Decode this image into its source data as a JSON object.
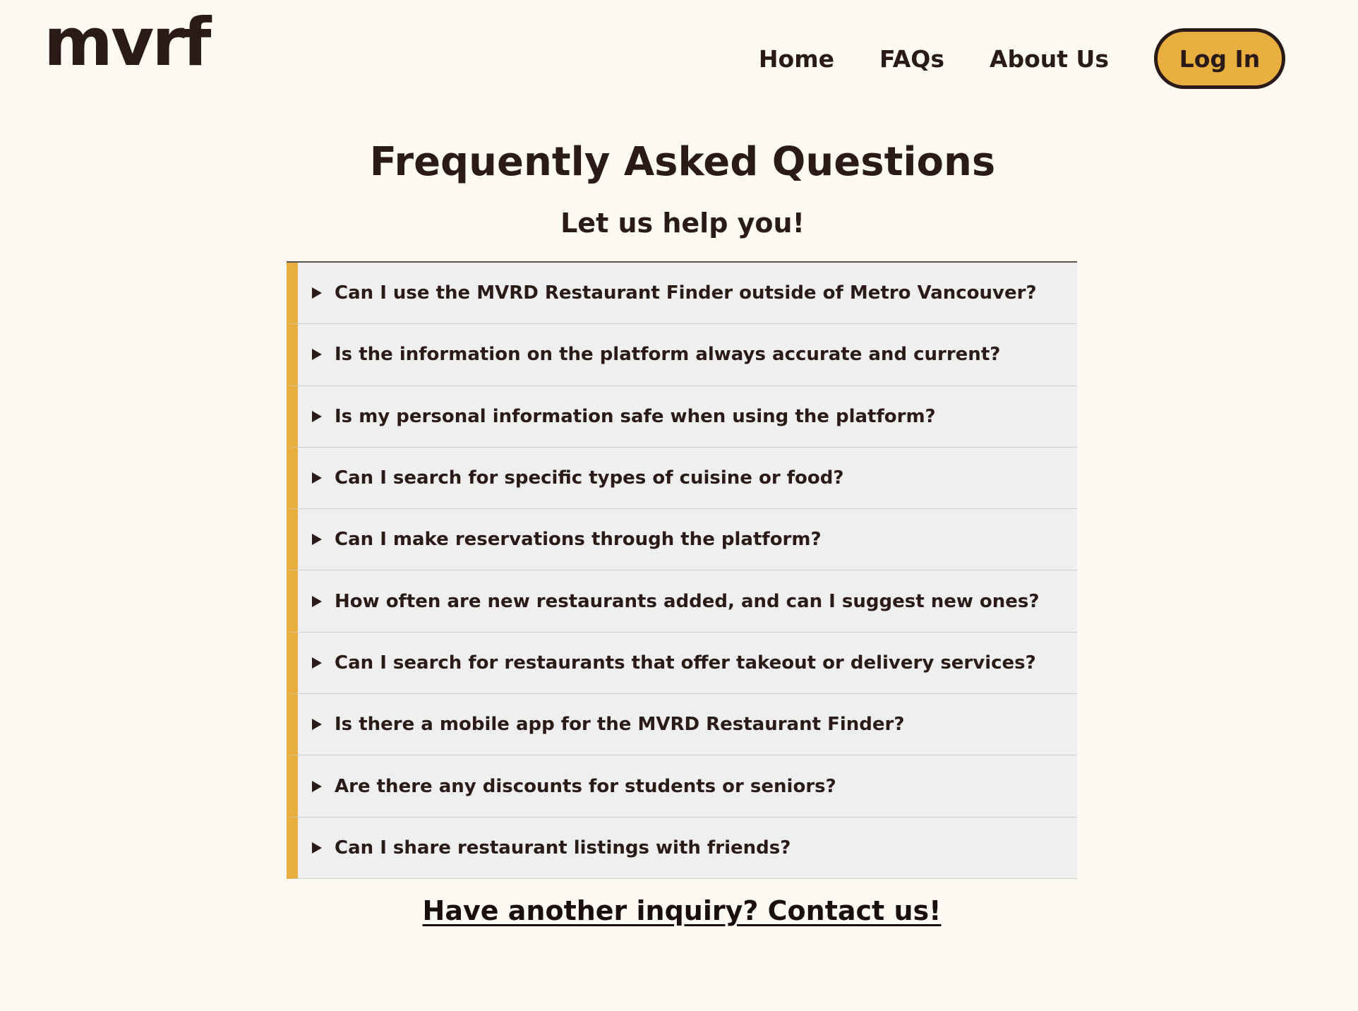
{
  "header": {
    "logo": "mvrf",
    "nav": [
      {
        "label": "Home"
      },
      {
        "label": "FAQs"
      },
      {
        "label": "About Us"
      }
    ],
    "login_label": "Log In"
  },
  "main": {
    "title": "Frequently Asked Questions",
    "subtitle": "Let us help you!",
    "faqs": [
      {
        "question": "Can I use the MVRD Restaurant Finder outside of Metro Vancouver?"
      },
      {
        "question": "Is the information on the platform always accurate and current?"
      },
      {
        "question": "Is my personal information safe when using the platform?"
      },
      {
        "question": "Can I search for specific types of cuisine or food?"
      },
      {
        "question": "Can I make reservations through the platform?"
      },
      {
        "question": "How often are new restaurants added, and can I suggest new ones?"
      },
      {
        "question": "Can I search for restaurants that offer takeout or delivery services?"
      },
      {
        "question": "Is there a mobile app for the MVRD Restaurant Finder?"
      },
      {
        "question": "Are there any discounts for students or seniors?"
      },
      {
        "question": "Can I share restaurant listings with friends?"
      }
    ],
    "contact_link": "Have another inquiry? Contact us!"
  },
  "colors": {
    "background": "#fdfaf4",
    "accent": "#e8ae3f",
    "text": "#2a1b18",
    "faq_background": "#efefef"
  },
  "icons": {
    "faq_toggle": "caret-right-icon"
  }
}
